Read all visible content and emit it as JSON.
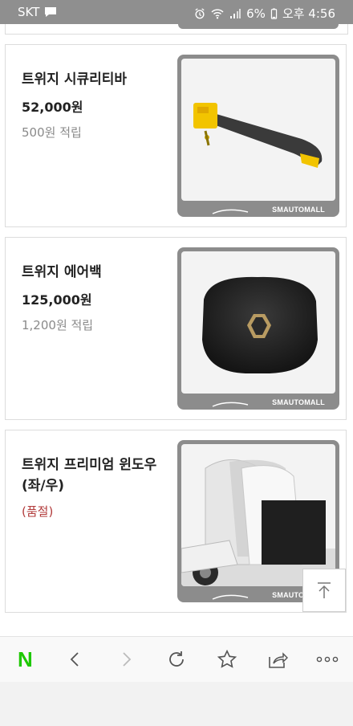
{
  "status_bar": {
    "carrier": "SKT",
    "battery": "6%",
    "time": "오후 4:56"
  },
  "products": [
    {
      "title": "트위지 시큐리티바",
      "price": "52,000원",
      "points": "500원 적립",
      "image_brand": "SMAUTOMALL"
    },
    {
      "title": "트위지 에어백",
      "price": "125,000원",
      "points": "1,200원 적립",
      "image_brand": "SMAUTOMALL"
    },
    {
      "title": "트위지 프리미엄 윈도우 (좌/우)",
      "status": "(품절)",
      "image_brand": "SMAUTOMALL"
    }
  ],
  "toolbar": {
    "home_label": "N",
    "icons": [
      "naver-home-icon",
      "back-icon",
      "forward-icon",
      "refresh-icon",
      "bookmark-star-icon",
      "share-icon",
      "more-icon"
    ]
  },
  "colors": {
    "naver_green": "#1ec800",
    "soldout_red": "#b23b3b"
  }
}
